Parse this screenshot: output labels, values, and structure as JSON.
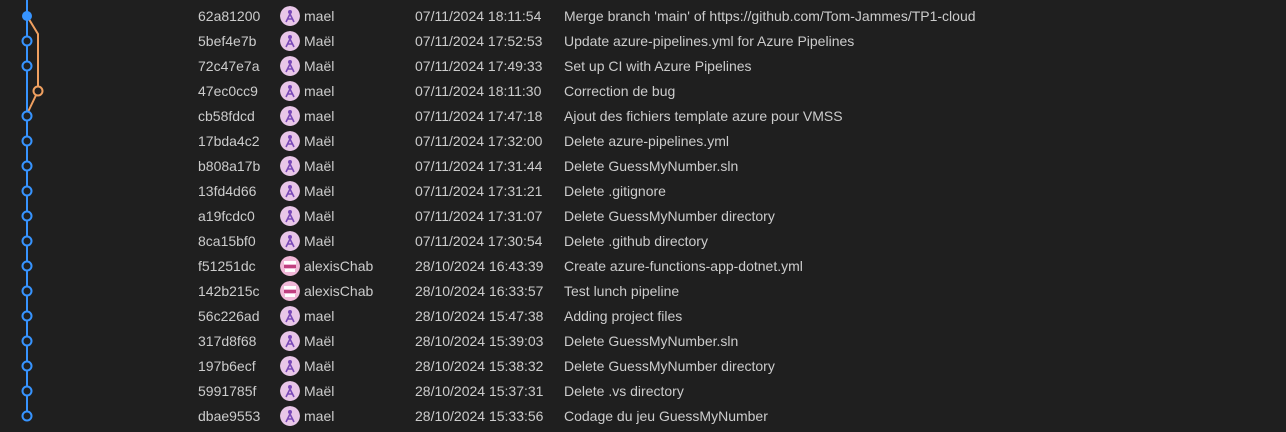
{
  "colors": {
    "background": "#1f1f1f",
    "text": "#cccccc",
    "graph_main_branch": "#3794ff",
    "graph_side_branch": "#f0a060",
    "avatar_mael_bg": "#e8c6e8",
    "avatar_mael_fg": "#7a4ab8",
    "avatar_alexis_bg": "#f1b8d8",
    "avatar_alexis_fg": "#c04080"
  },
  "commits": [
    {
      "hash": "62a81200",
      "author": "mael",
      "avatar": "mael-avatar-icon",
      "date": "07/11/2024 18:11:54",
      "message": "Merge branch 'main' of https://github.com/Tom-Jammes/TP1-cloud",
      "lane": "main",
      "merge": true
    },
    {
      "hash": "5bef4e7b",
      "author": "Maël",
      "avatar": "mael-avatar-icon",
      "date": "07/11/2024 17:52:53",
      "message": "Update azure-pipelines.yml for Azure Pipelines",
      "lane": "main"
    },
    {
      "hash": "72c47e7a",
      "author": "Maël",
      "avatar": "mael-avatar-icon",
      "date": "07/11/2024 17:49:33",
      "message": "Set up CI with Azure Pipelines",
      "lane": "main"
    },
    {
      "hash": "47ec0cc9",
      "author": "mael",
      "avatar": "mael-avatar-icon",
      "date": "07/11/2024 18:11:30",
      "message": "Correction de bug",
      "lane": "side"
    },
    {
      "hash": "cb58fdcd",
      "author": "mael",
      "avatar": "mael-avatar-icon",
      "date": "07/11/2024 17:47:18",
      "message": "Ajout des fichiers template azure pour VMSS",
      "lane": "main"
    },
    {
      "hash": "17bda4c2",
      "author": "Maël",
      "avatar": "mael-avatar-icon",
      "date": "07/11/2024 17:32:00",
      "message": "Delete azure-pipelines.yml",
      "lane": "main"
    },
    {
      "hash": "b808a17b",
      "author": "Maël",
      "avatar": "mael-avatar-icon",
      "date": "07/11/2024 17:31:44",
      "message": "Delete GuessMyNumber.sln",
      "lane": "main"
    },
    {
      "hash": "13fd4d66",
      "author": "Maël",
      "avatar": "mael-avatar-icon",
      "date": "07/11/2024 17:31:21",
      "message": "Delete .gitignore",
      "lane": "main"
    },
    {
      "hash": "a19fcdc0",
      "author": "Maël",
      "avatar": "mael-avatar-icon",
      "date": "07/11/2024 17:31:07",
      "message": "Delete GuessMyNumber directory",
      "lane": "main"
    },
    {
      "hash": "8ca15bf0",
      "author": "Maël",
      "avatar": "mael-avatar-icon",
      "date": "07/11/2024 17:30:54",
      "message": "Delete .github directory",
      "lane": "main"
    },
    {
      "hash": "f51251dc",
      "author": "alexisChab",
      "avatar": "alexis-avatar-icon",
      "date": "28/10/2024 16:43:39",
      "message": "Create azure-functions-app-dotnet.yml",
      "lane": "main"
    },
    {
      "hash": "142b215c",
      "author": "alexisChab",
      "avatar": "alexis-avatar-icon",
      "date": "28/10/2024 16:33:57",
      "message": "Test lunch pipeline",
      "lane": "main"
    },
    {
      "hash": "56c226ad",
      "author": "mael",
      "avatar": "mael-avatar-icon",
      "date": "28/10/2024 15:47:38",
      "message": "Adding project files",
      "lane": "main"
    },
    {
      "hash": "317d8f68",
      "author": "Maël",
      "avatar": "mael-avatar-icon",
      "date": "28/10/2024 15:39:03",
      "message": "Delete GuessMyNumber.sln",
      "lane": "main"
    },
    {
      "hash": "197b6ecf",
      "author": "Maël",
      "avatar": "mael-avatar-icon",
      "date": "28/10/2024 15:38:32",
      "message": "Delete GuessMyNumber directory",
      "lane": "main"
    },
    {
      "hash": "5991785f",
      "author": "Maël",
      "avatar": "mael-avatar-icon",
      "date": "28/10/2024 15:37:31",
      "message": "Delete .vs directory",
      "lane": "main"
    },
    {
      "hash": "dbae9553",
      "author": "mael",
      "avatar": "mael-avatar-icon",
      "date": "28/10/2024 15:33:56",
      "message": "Codage du jeu GuessMyNumber",
      "lane": "main"
    }
  ]
}
